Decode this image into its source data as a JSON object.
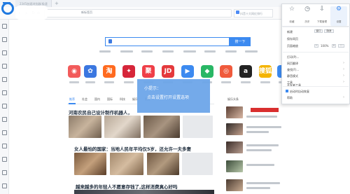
{
  "browser": {
    "tab_title": "2345加速浏览器(极速版)",
    "url_text": "新标签页",
    "search_placeholder": "抖音十大网红排行",
    "nav": [
      "◀",
      "▶",
      "↻",
      "⌂"
    ]
  },
  "search": {
    "button_label": "搜一下"
  },
  "tooltip": {
    "title": "小提示：",
    "message": "点击设置打开设置选项"
  },
  "apps": [
    {
      "name": "app-weibo",
      "glyph": "◉",
      "color": "#f25b5b"
    },
    {
      "name": "app-baidu",
      "glyph": "✿",
      "color": "#3b77e0"
    },
    {
      "name": "app-taobao",
      "glyph": "淘",
      "color": "#ff6a1f"
    },
    {
      "name": "app-tmall",
      "glyph": "✦",
      "color": "#d6263a"
    },
    {
      "name": "app-ju",
      "glyph": "聚",
      "color": "#ef3f48"
    },
    {
      "name": "app-jd",
      "glyph": "JD",
      "color": "#e4393c"
    },
    {
      "name": "app-video",
      "glyph": "▶",
      "color": "#3c8af0"
    },
    {
      "name": "app-game",
      "glyph": "◆",
      "color": "#29b765"
    },
    {
      "name": "app-music",
      "glyph": "◎",
      "color": "#f05a3c"
    },
    {
      "name": "app-amazon",
      "glyph": "a",
      "color": "#222222"
    },
    {
      "name": "app-sohu",
      "glyph": "搜狐",
      "color": "#f4b400"
    },
    {
      "name": "app-ctrip",
      "glyph": "✈",
      "color": "#3c8af0"
    }
  ],
  "news": {
    "tabs": [
      "推荐",
      "社会",
      "国内",
      "国际",
      "科技",
      "娱乐",
      "财经"
    ],
    "headlines": [
      "河南农民自己设计制作机器人，",
      "女人最怕的国家：当地人民年平均仅5岁，还允许一夫多妻",
      "越来越多的年轻人不愿意存钱了,这样消费真心好吗"
    ],
    "right_head": "娱乐头条"
  },
  "panel": {
    "icons": [
      {
        "name": "favorite-icon",
        "glyph": "☆",
        "label": "收藏"
      },
      {
        "name": "history-icon",
        "glyph": "◷",
        "label": "历史"
      },
      {
        "name": "download-icon",
        "glyph": "⇩",
        "label": "下载管理"
      },
      {
        "name": "settings-icon",
        "glyph": "⚙",
        "label": "设置"
      }
    ],
    "rows": [
      {
        "label": "新建",
        "right": "窗口 隐身窗口"
      },
      {
        "label": "保存网页",
        "right": ""
      },
      {
        "label": "页面缩放",
        "right": "100%"
      },
      {
        "label": "打印(P)...",
        "right": ""
      },
      {
        "label": "网页翻译",
        "right": ""
      },
      {
        "label": "查找(F)...",
        "right": ""
      },
      {
        "label": "静音模式",
        "right": ""
      },
      {
        "label": "工具",
        "right": ""
      },
      {
        "label": "开发者工具",
        "right": ""
      },
      {
        "label": "启动时自动恢复",
        "right": ""
      },
      {
        "label": "帮助",
        "right": ""
      }
    ]
  }
}
